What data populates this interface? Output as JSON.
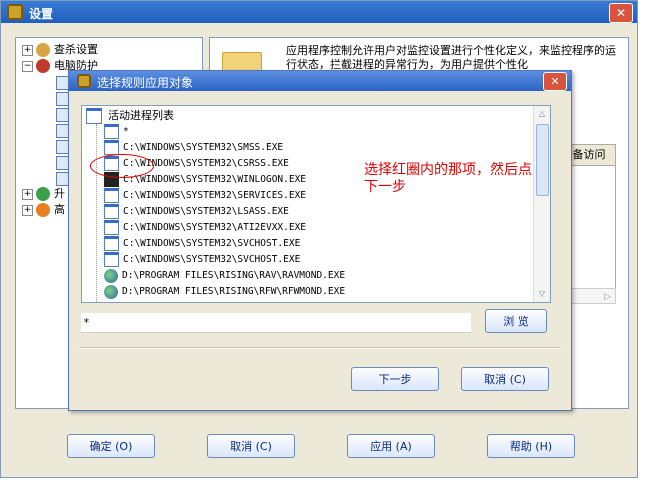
{
  "main_window": {
    "title": "设置",
    "close_label": "✕",
    "tree": {
      "items": [
        {
          "label": "查杀设置",
          "expander": "+"
        },
        {
          "label": "电脑防护",
          "expander": "−"
        },
        {
          "label": "升",
          "expander": "+"
        },
        {
          "label": "高",
          "expander": "+"
        }
      ]
    },
    "description": "应用程序控制允许用户对监控设置进行个性化定义，来监控程序的运行状态，拦截进程的异常行为，为用户提供个性化",
    "column_header": "备访问",
    "footer_buttons": {
      "ok": "确定 (O)",
      "cancel": "取消 (C)",
      "apply": "应用 (A)",
      "help": "帮助 (H)"
    }
  },
  "dialog": {
    "title": "选择规则应用对象",
    "close_label": "✕",
    "list_header": "活动进程列表",
    "processes": [
      {
        "path": "*",
        "icon": "window"
      },
      {
        "path": "C:\\WINDOWS\\SYSTEM32\\SMSS.EXE",
        "icon": "window"
      },
      {
        "path": "C:\\WINDOWS\\SYSTEM32\\CSRSS.EXE",
        "icon": "window"
      },
      {
        "path": "C:\\WINDOWS\\SYSTEM32\\WINLOGON.EXE",
        "icon": "lock"
      },
      {
        "path": "C:\\WINDOWS\\SYSTEM32\\SERVICES.EXE",
        "icon": "window"
      },
      {
        "path": "C:\\WINDOWS\\SYSTEM32\\LSASS.EXE",
        "icon": "window"
      },
      {
        "path": "C:\\WINDOWS\\SYSTEM32\\ATI2EVXX.EXE",
        "icon": "window"
      },
      {
        "path": "C:\\WINDOWS\\SYSTEM32\\SVCHOST.EXE",
        "icon": "window"
      },
      {
        "path": "C:\\WINDOWS\\SYSTEM32\\SVCHOST.EXE",
        "icon": "window"
      },
      {
        "path": "D:\\PROGRAM FILES\\RISING\\RAV\\RAVMOND.EXE",
        "icon": "globe"
      },
      {
        "path": "D:\\PROGRAM FILES\\RISING\\RFW\\RFWMOND.EXE",
        "icon": "globe"
      }
    ],
    "annotation": "选择红圈内的那项，然后点下一步",
    "path_value": "*",
    "browse_label": "浏 览",
    "next_label": "下一步",
    "cancel_label": "取消 (C)",
    "annotation_color": "#e00000"
  }
}
